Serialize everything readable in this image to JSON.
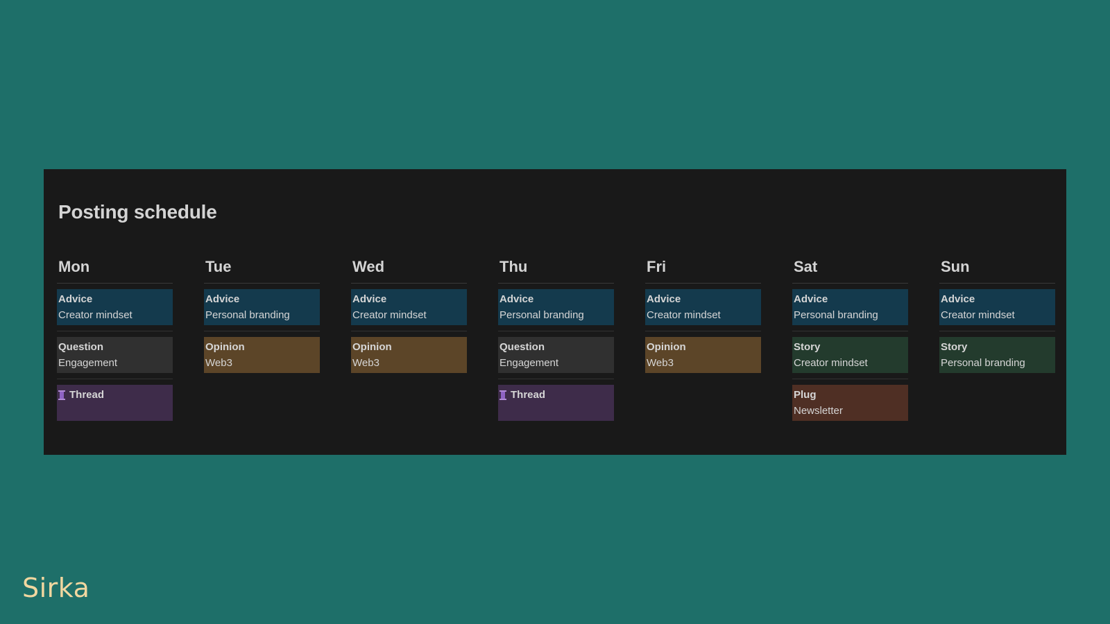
{
  "title": "Posting schedule",
  "brand": "Sirka",
  "colors": {
    "background": "#1e6f69",
    "panel": "#191919",
    "advice": "#143a4d",
    "question": "#303030",
    "opinion": "#5c4528",
    "story": "#233b2d",
    "thread": "#3e2c4a",
    "plug": "#4f2f24",
    "brand": "#f1d7a0"
  },
  "days": [
    {
      "name": "Mon",
      "cards": [
        {
          "type": "Advice",
          "topic": "Creator mindset",
          "style": "advice"
        },
        {
          "type": "Question",
          "topic": "Engagement",
          "style": "question"
        },
        {
          "type": "Thread",
          "topic": "",
          "style": "thread",
          "icon": "thread-spool-icon"
        }
      ]
    },
    {
      "name": "Tue",
      "cards": [
        {
          "type": "Advice",
          "topic": "Personal branding",
          "style": "advice"
        },
        {
          "type": "Opinion",
          "topic": "Web3",
          "style": "opinion"
        }
      ]
    },
    {
      "name": "Wed",
      "cards": [
        {
          "type": "Advice",
          "topic": "Creator mindset",
          "style": "advice"
        },
        {
          "type": "Opinion",
          "topic": "Web3",
          "style": "opinion"
        }
      ]
    },
    {
      "name": "Thu",
      "cards": [
        {
          "type": "Advice",
          "topic": "Personal branding",
          "style": "advice"
        },
        {
          "type": "Question",
          "topic": "Engagement",
          "style": "question"
        },
        {
          "type": "Thread",
          "topic": "",
          "style": "thread",
          "icon": "thread-spool-icon"
        }
      ]
    },
    {
      "name": "Fri",
      "cards": [
        {
          "type": "Advice",
          "topic": "Creator mindset",
          "style": "advice"
        },
        {
          "type": "Opinion",
          "topic": "Web3",
          "style": "opinion"
        }
      ]
    },
    {
      "name": "Sat",
      "cards": [
        {
          "type": "Advice",
          "topic": "Personal branding",
          "style": "advice"
        },
        {
          "type": "Story",
          "topic": "Creator mindset",
          "style": "story"
        },
        {
          "type": "Plug",
          "topic": "Newsletter",
          "style": "plug"
        }
      ]
    },
    {
      "name": "Sun",
      "cards": [
        {
          "type": "Advice",
          "topic": "Creator mindset",
          "style": "advice"
        },
        {
          "type": "Story",
          "topic": "Personal branding",
          "style": "story"
        }
      ]
    }
  ]
}
